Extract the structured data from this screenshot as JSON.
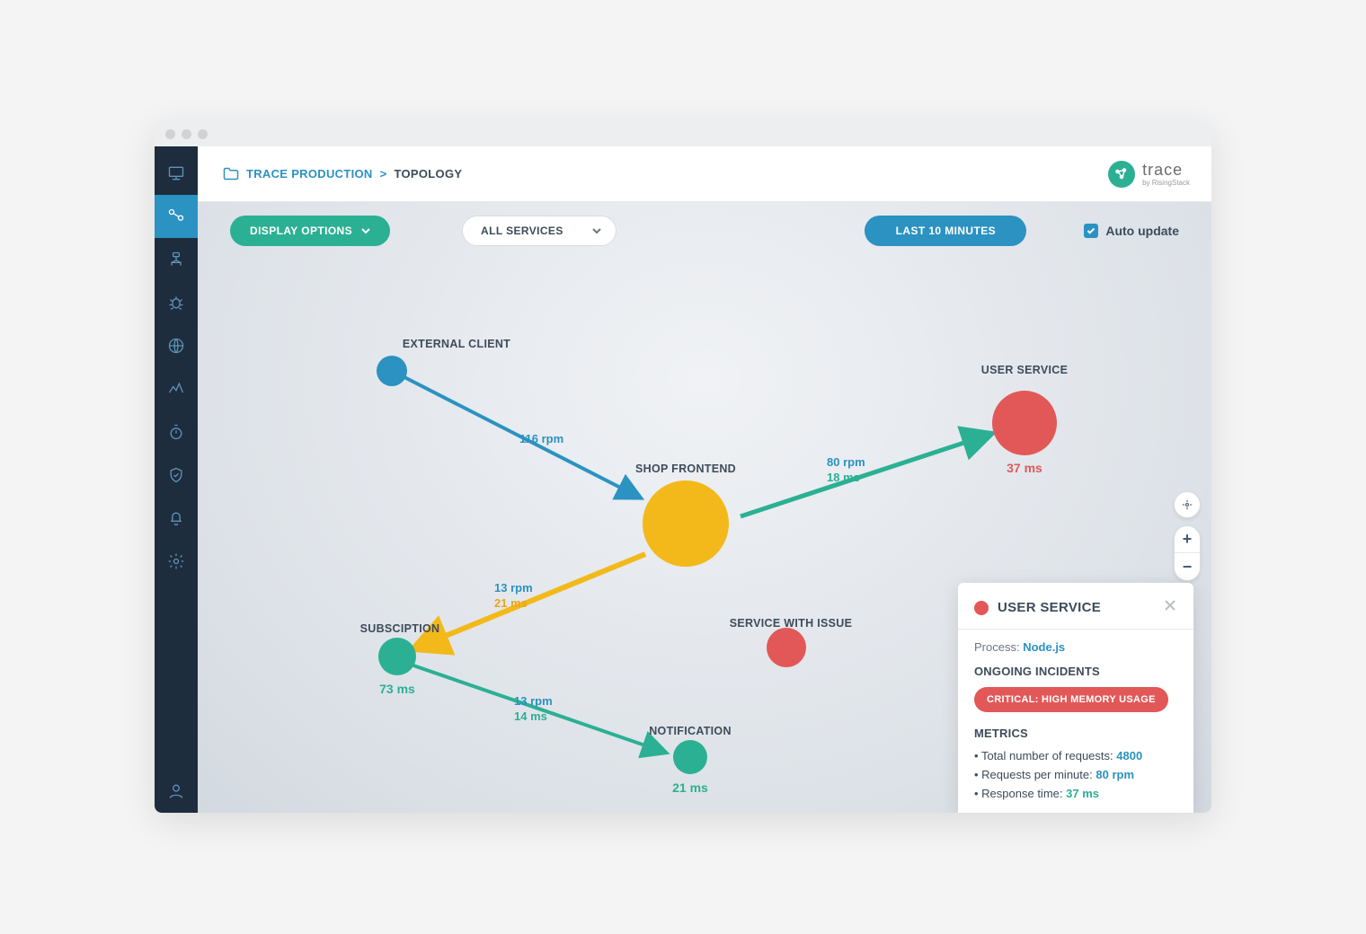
{
  "breadcrumb": {
    "app": "TRACE PRODUCTION",
    "sep": ">",
    "page": "TOPOLOGY"
  },
  "brand": {
    "name": "trace",
    "sub": "by RisingStack"
  },
  "toolbar": {
    "display_options": "DISPLAY OPTIONS",
    "services_filter": "ALL SERVICES",
    "timerange": "LAST 10 MINUTES",
    "auto_update": "Auto update"
  },
  "nodes": {
    "external_client": {
      "label": "EXTERNAL CLIENT"
    },
    "shop_frontend": {
      "label": "SHOP FRONTEND"
    },
    "user_service": {
      "label": "USER SERVICE",
      "metric": "37 ms"
    },
    "subscription": {
      "label": "SUBSCIPTION",
      "metric": "73 ms"
    },
    "service_issue": {
      "label": "SERVICE WITH ISSUE"
    },
    "notification": {
      "label": "NOTIFICATION",
      "metric": "21 ms"
    }
  },
  "edges": {
    "ec_sf": {
      "rpm": "116 rpm"
    },
    "sf_us": {
      "rpm": "80 rpm",
      "ms": "18 ms"
    },
    "sf_sub": {
      "rpm": "13 rpm",
      "ms": "21 ms"
    },
    "sub_not": {
      "rpm": "13 rpm",
      "ms": "14 ms"
    }
  },
  "colors": {
    "blue": "#2b92c1",
    "teal": "#2bb093",
    "yellow": "#f3b91b",
    "red": "#e25858",
    "dark": "#1d2d3e"
  },
  "panel": {
    "title": "USER SERVICE",
    "process_label": "Process:",
    "process_value": "Node.js",
    "incidents_heading": "ONGOING INCIDENTS",
    "incident_pill": "CRITICAL: HIGH MEMORY USAGE",
    "metrics_heading": "METRICS",
    "metrics": {
      "requests_total": {
        "label": "Total number of requests:",
        "value": "4800"
      },
      "rpm": {
        "label": "Requests per minute:",
        "value": "80 rpm"
      },
      "response_time": {
        "label": "Response time:",
        "value": "37 ms"
      }
    }
  },
  "zoom": {
    "plus": "+",
    "minus": "−"
  }
}
